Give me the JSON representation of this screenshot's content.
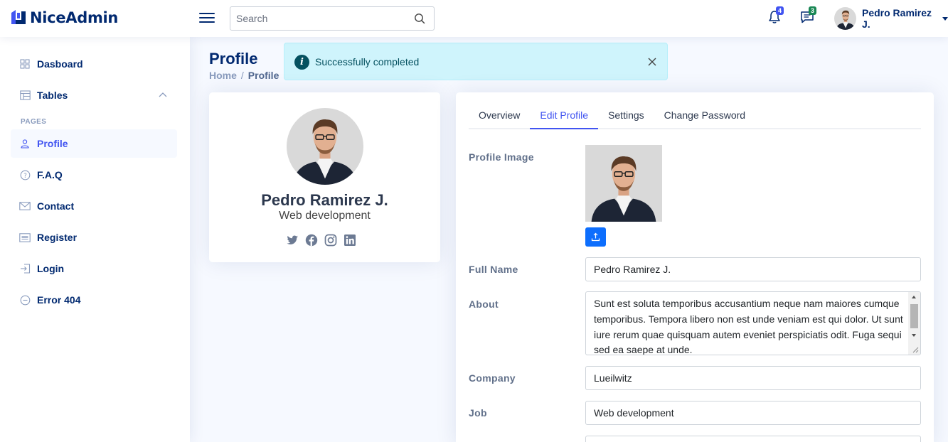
{
  "app": {
    "name": "NiceAdmin"
  },
  "header": {
    "search_placeholder": "Search",
    "notifications_count": "4",
    "messages_count": "3",
    "user_name": "Pedro Ramirez J."
  },
  "sidebar": {
    "items": [
      {
        "label": "Dasboard",
        "icon": "grid-icon"
      },
      {
        "label": "Tables",
        "icon": "table-icon"
      }
    ],
    "section_heading": "Pages",
    "pages": [
      {
        "label": "Profile",
        "icon": "person-icon",
        "active": true
      },
      {
        "label": "F.A.Q",
        "icon": "question-circle-icon"
      },
      {
        "label": "Contact",
        "icon": "envelope-icon"
      },
      {
        "label": "Register",
        "icon": "card-list-icon"
      },
      {
        "label": "Login",
        "icon": "box-arrow-in-right-icon"
      },
      {
        "label": "Error 404",
        "icon": "dash-circle-icon"
      }
    ]
  },
  "page": {
    "title": "Profile",
    "breadcrumb": [
      "Home",
      "Profile"
    ]
  },
  "alert": {
    "message": "Successfully completed"
  },
  "profile_card": {
    "name": "Pedro Ramirez J.",
    "job": "Web development",
    "socials": [
      "twitter-icon",
      "facebook-icon",
      "instagram-icon",
      "linkedin-icon"
    ]
  },
  "tabs": [
    "Overview",
    "Edit Profile",
    "Settings",
    "Change Password"
  ],
  "active_tab": "Edit Profile",
  "form": {
    "profile_image_label": "Profile Image",
    "full_name_label": "Full Name",
    "full_name_value": "Pedro Ramirez J.",
    "about_label": "About",
    "about_value": "Sunt est soluta temporibus accusantium neque nam maiores cumque temporibus. Tempora libero non est unde veniam est qui dolor. Ut sunt iure rerum quae quisquam autem eveniet perspiciatis odit. Fuga sequi sed ea saepe at unde.",
    "company_label": "Company",
    "company_value": "Lueilwitz",
    "job_label": "Job",
    "job_value": "Web development"
  },
  "colors": {
    "brand": "#012970",
    "accent": "#4154f1",
    "alert_bg": "#cff4fc",
    "alert_text": "#055160",
    "upload_button": "#0d6efd"
  }
}
